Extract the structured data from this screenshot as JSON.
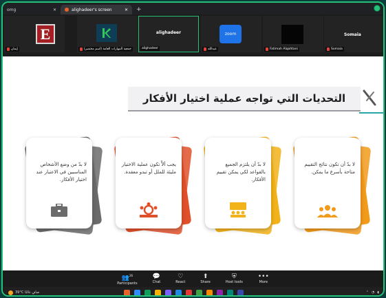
{
  "browser": {
    "tabs": [
      {
        "label": "omg"
      },
      {
        "label": "alighadeer's screen"
      }
    ],
    "new_tab": "+"
  },
  "participants": [
    {
      "name": "إيمان",
      "avatar_letter": "E"
    },
    {
      "name": "جمعية المهارات العامة (اسم مختصر)"
    },
    {
      "name": "alighadeer",
      "center_label": "alighadeer"
    },
    {
      "name": "عبدالله",
      "avatar_text": "zoom"
    },
    {
      "name": "Fatimah Alqahtani"
    },
    {
      "name": "Somaia",
      "center_label": "Somaia"
    }
  ],
  "slide": {
    "title": "التحديات التي تواجه عملية اختيار الأفكار",
    "cards": [
      {
        "text": "لا بدّ أن تكون نتائج التقييم متاحة بأسرع ما يمكن.",
        "color": "#f29a1a",
        "icon": "people-icon"
      },
      {
        "text": "لا بدّ أن يلتزم الجميع بالقواعد لكي يمكن تقييم الأفكار.",
        "color": "#f2b21a",
        "icon": "presentation-icon"
      },
      {
        "text": "يجب ألاَّ تكون عملية الاختيار مليئة للملل أو تبدو معقدة.",
        "color": "#e0502a",
        "icon": "team-icon"
      },
      {
        "text": "لا بدّ من وضع الأشخاص المناسبين في الاعتبار عند اختيار الأفكار.",
        "color": "#6b6b6b",
        "icon": "briefcase-icon"
      }
    ]
  },
  "toolbar": {
    "items": [
      {
        "label": "Participants",
        "count": "26",
        "icon": "participants-icon"
      },
      {
        "label": "Chat",
        "icon": "chat-icon"
      },
      {
        "label": "React",
        "icon": "heart-icon"
      },
      {
        "label": "Share",
        "icon": "share-icon"
      },
      {
        "label": "Host tools",
        "icon": "shield-icon"
      },
      {
        "label": "More",
        "icon": "more-icon"
      }
    ]
  },
  "taskbar": {
    "weather": "39°C صافٍ غالبًا",
    "time": "",
    "app_colors": [
      "#e8622c",
      "#2d8cff",
      "#0f9d58",
      "#f4b400",
      "#7b61ff",
      "#1e88e5",
      "#e53935",
      "#43a047",
      "#fb8c00",
      "#8e24aa",
      "#00897b",
      "#3949ab"
    ]
  }
}
